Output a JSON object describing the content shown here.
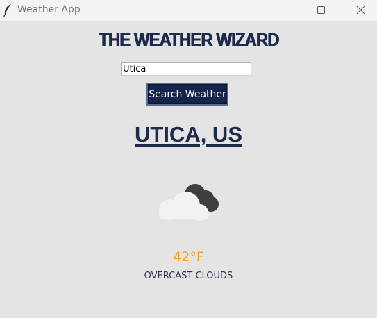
{
  "window": {
    "title": "Weather App",
    "icon": "feather-icon"
  },
  "header": {
    "title": "THE WEATHER WIZARD"
  },
  "search": {
    "value": "Utica",
    "button_label": "Search Weather"
  },
  "result": {
    "location": "UTICA, US",
    "condition_icon": "overcast-clouds-icon",
    "temperature": "42°F",
    "description": "OVERCAST CLOUDS"
  },
  "colors": {
    "background": "#e4e4e4",
    "titlebar": "#f3f3f3",
    "heading": "#1d2a4a",
    "button": "#152448",
    "temperature": "#f2a51a"
  }
}
